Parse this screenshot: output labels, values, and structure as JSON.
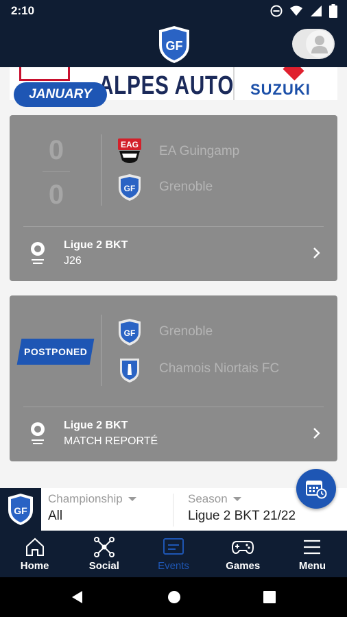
{
  "status_bar": {
    "time": "2:10",
    "icons": [
      "do-not-disturb-icon",
      "wifi-icon",
      "cell-signal-icon",
      "battery-icon"
    ]
  },
  "header": {
    "logo": "grenoble-foot-38-logo",
    "logo_letters": "GF",
    "profile": "profile-avatar-icon"
  },
  "sponsor": {
    "main_text": "ALPES AUTO",
    "right_text": "SUZUKI"
  },
  "month_label": "JANUARY",
  "matches": [
    {
      "home_score": "0",
      "away_score": "0",
      "home_team": "EA Guingamp",
      "home_team_logo": "EAG",
      "away_team": "Grenoble",
      "competition": "Ligue 2 BKT",
      "round": "J26"
    },
    {
      "status": "POSTPONED",
      "home_team": "Grenoble",
      "away_team": "Chamois Niortais FC",
      "competition": "Ligue 2 BKT",
      "round": "MATCH REPORTÉ"
    }
  ],
  "filters": {
    "championship_label": "Championship",
    "championship_value": "All",
    "season_label": "Season",
    "season_value": "Ligue 2 BKT 21/22"
  },
  "bottom_nav": [
    {
      "label": "Home",
      "icon": "home-icon"
    },
    {
      "label": "Social",
      "icon": "social-network-icon"
    },
    {
      "label": "Events",
      "icon": "events-icon",
      "active": true
    },
    {
      "label": "Games",
      "icon": "gamepad-icon"
    },
    {
      "label": "Menu",
      "icon": "menu-icon"
    }
  ],
  "colors": {
    "navy": "#0f1d33",
    "accent_blue": "#1e56b4",
    "card_gray": "#8b8b8b",
    "eag_red": "#d3202a"
  }
}
